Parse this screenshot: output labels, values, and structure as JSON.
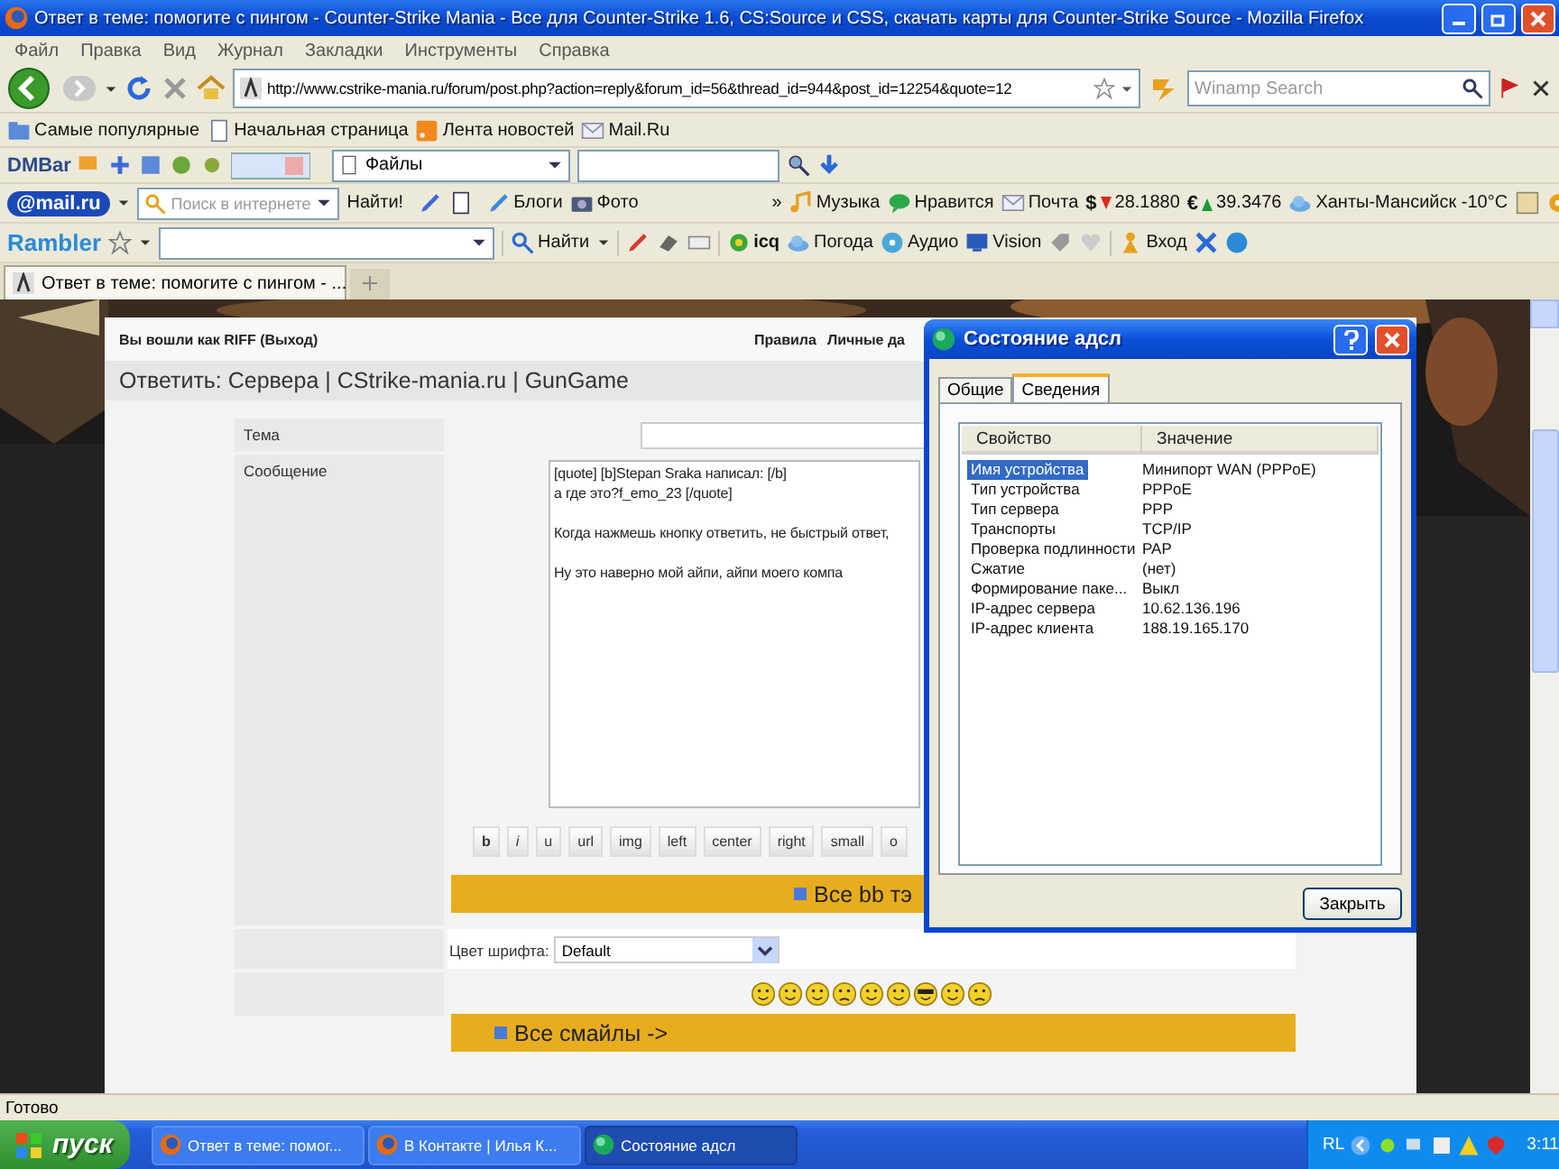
{
  "window": {
    "title": "Ответ в теме: помогите с пингом - Counter-Strike Mania - Все для Counter-Strike 1.6, CS:Source и CSS, скачать карты для Counter-Strike Source - Mozilla Firefox"
  },
  "menu": [
    "Файл",
    "Правка",
    "Вид",
    "Журнал",
    "Закладки",
    "Инструменты",
    "Справка"
  ],
  "address": {
    "url": "http://www.cstrike-mania.ru/forum/post.php?action=reply&forum_id=56&thread_id=944&post_id=12254&quote=12"
  },
  "search": {
    "placeholder": "Winamp Search"
  },
  "bookmarks": [
    {
      "kind": "folder",
      "label": "Самые популярные"
    },
    {
      "kind": "page",
      "label": "Начальная страница"
    },
    {
      "kind": "feed",
      "label": "Лента новостей"
    },
    {
      "kind": "mail",
      "label": "Mail.Ru"
    }
  ],
  "dmbar": {
    "logo": "DMBar",
    "files": "Файлы"
  },
  "mailru": {
    "logo": "@mail.ru",
    "search": {
      "placeholder": "Поиск в интернете"
    },
    "find": "Найти!",
    "more": "»",
    "items_left": [
      {
        "kind": "blog",
        "label": "Блоги"
      },
      {
        "label": "Фото"
      }
    ],
    "items_right": [
      {
        "kind": "music",
        "label": "Музыка"
      },
      {
        "kind": "like",
        "label": "Нравится"
      },
      {
        "kind": "mail",
        "label": "Почта"
      },
      {
        "kind": "currency",
        "symbol": "$",
        "label": "28.1880",
        "rising": false
      },
      {
        "kind": "currency",
        "symbol": "€",
        "label": "39.3476",
        "rising": true
      },
      {
        "kind": "weather",
        "label": "Ханты-Мансийск -10°C"
      }
    ]
  },
  "rambler": {
    "logo": "Rambler",
    "find": "Найти",
    "services": [
      {
        "kind": "icq",
        "label": "icq"
      },
      {
        "kind": "weather",
        "label": "Погода"
      },
      {
        "kind": "audio",
        "label": "Аудио"
      },
      {
        "kind": "vision",
        "label": "Vision"
      }
    ],
    "login": "Вход"
  },
  "tabs": [
    {
      "label": "Ответ в теме: помогите с пингом - ...",
      "selected": true
    }
  ],
  "page": {
    "login": "Вы вошли как RIFF (Выход)",
    "links": [
      "Правила",
      "Личные да"
    ],
    "heading": "Ответить: Сервера | CStrike-mania.ru | GunGame",
    "form": {
      "subject_label": "Тема",
      "message_label": "Сообщение",
      "message": [
        [
          "[quote] [b]Stepan Sraka написал: [/b]",
          "а где это?f_emo_23 [/quote]"
        ],
        [
          "Когда нажмешь кнопку ответить, не быстрый ответ,"
        ],
        [
          "Ну это наверно мой айпи, айпи моего компа"
        ]
      ],
      "bb_buttons": [
        "b",
        "i",
        "u",
        "url",
        "img",
        "left",
        "center",
        "right",
        "small",
        "o"
      ],
      "bb_all": "Все bb тэ",
      "color_label": "Цвет шрифта:",
      "color_value": "Default",
      "smileys_all": "Все смайлы ->"
    }
  },
  "dialog": {
    "title": "Состояние адсл",
    "tabs": [
      {
        "label": "Общие",
        "selected": false
      },
      {
        "label": "Сведения",
        "selected": true
      }
    ],
    "columns": [
      "Свойство",
      "Значение"
    ],
    "rows": [
      {
        "property": "Имя устройства",
        "value": "Минипорт WAN (PPPoE)",
        "selected": true
      },
      {
        "property": "Тип устройства",
        "value": "PPPoE",
        "selected": false
      },
      {
        "property": "Тип сервера",
        "value": "PPP",
        "selected": false
      },
      {
        "property": "Транспорты",
        "value": "TCP/IP",
        "selected": false
      },
      {
        "property": "Проверка подлинности",
        "value": "PAP",
        "selected": false
      },
      {
        "property": "Сжатие",
        "value": "(нет)",
        "selected": false
      },
      {
        "property": "Формирование паке...",
        "value": "Выкл",
        "selected": false
      },
      {
        "property": "IP-адрес сервера",
        "value": "10.62.136.196",
        "selected": false
      },
      {
        "property": "IP-адрес клиента",
        "value": "188.19.165.170",
        "selected": false
      }
    ],
    "close": "Закрыть"
  },
  "status": "Готово",
  "taskbar": {
    "start": "пуск",
    "tasks": [
      {
        "kind": "browser",
        "label": "Ответ в теме: помог...",
        "selected": false
      },
      {
        "kind": "browser",
        "label": "В Контакте | Илья К...",
        "selected": false
      },
      {
        "kind": "network",
        "label": "Состояние адсл",
        "selected": true
      }
    ],
    "lang": "RL",
    "clock": "3:11"
  }
}
